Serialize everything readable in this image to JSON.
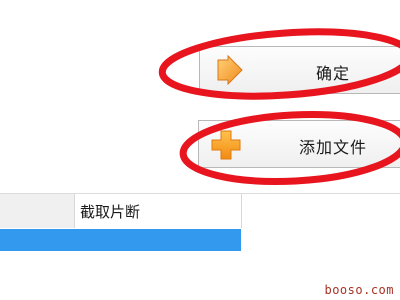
{
  "buttons": {
    "confirm": {
      "label": "确定",
      "icon": "arrow-right-icon"
    },
    "add_file": {
      "label": "添加文件",
      "icon": "plus-icon"
    }
  },
  "table": {
    "columns": [
      "",
      "截取片断"
    ],
    "selected_row_color": "#3399ee"
  },
  "watermark": "booso.com",
  "annotation_color": "#e8141e"
}
